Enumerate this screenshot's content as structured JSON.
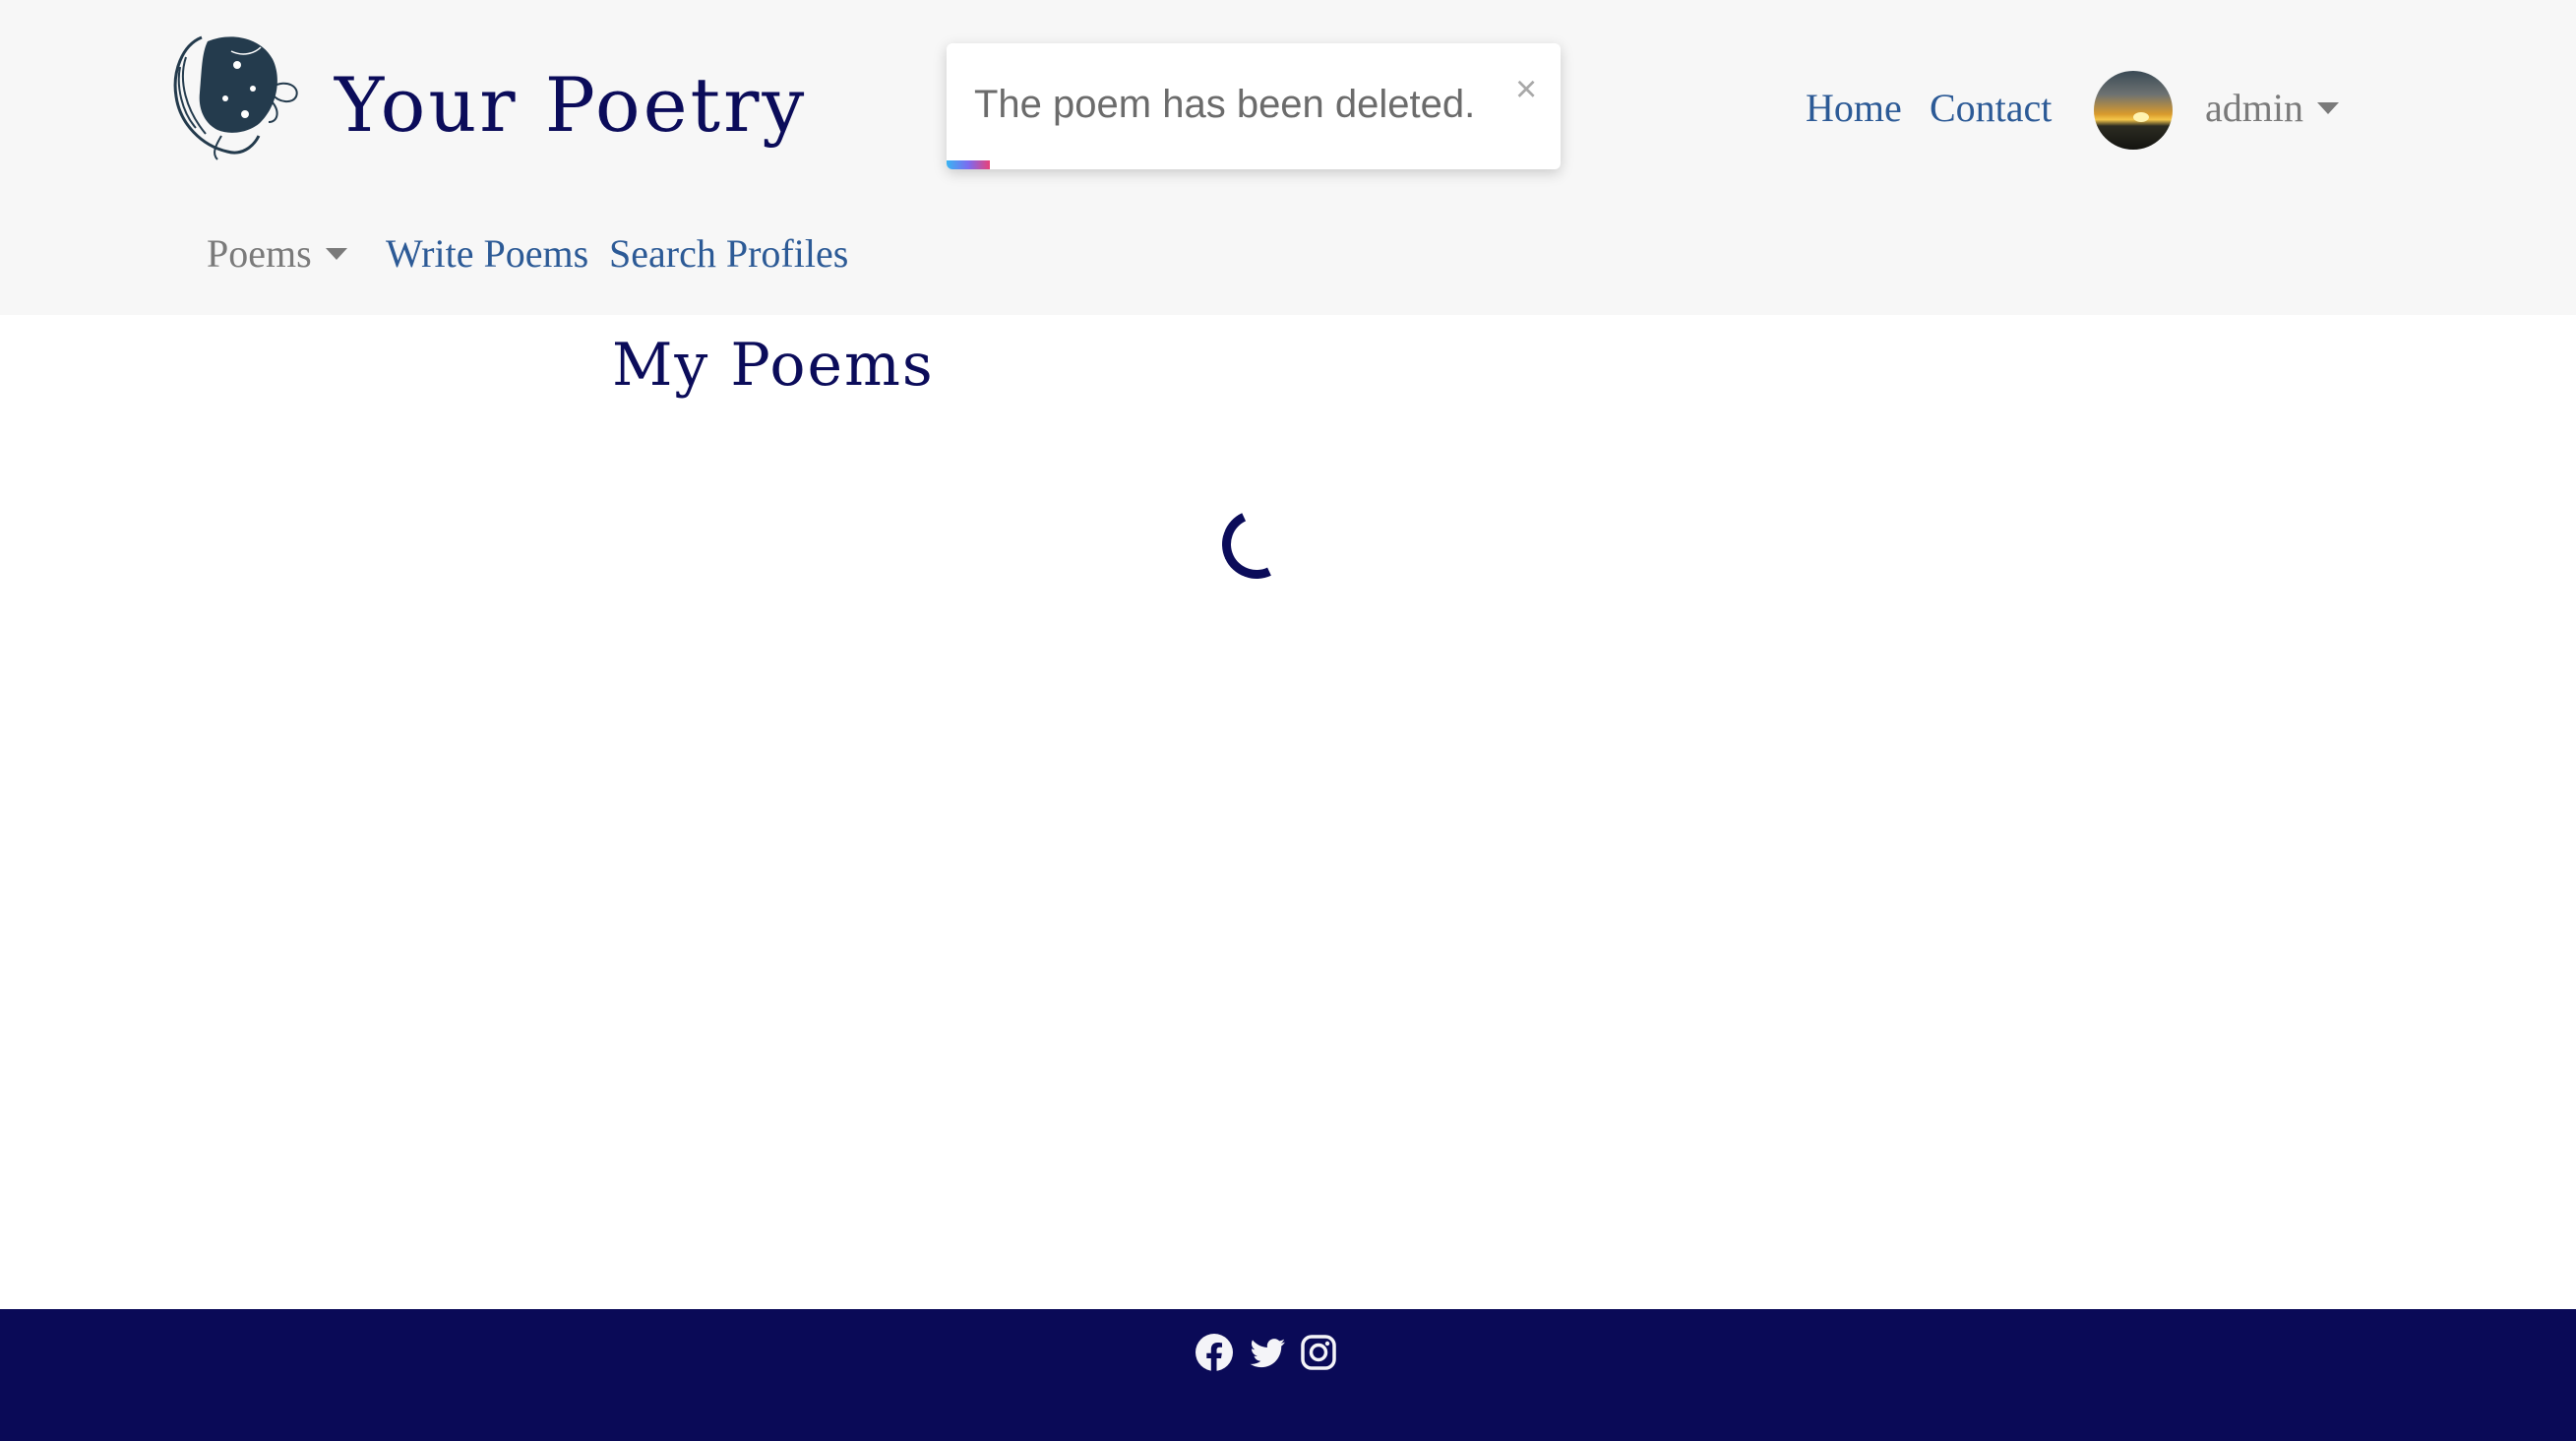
{
  "header": {
    "brand": "Your Poetry",
    "nav_left": [
      {
        "label": "Poems",
        "dropdown": true
      },
      {
        "label": "Write Poems"
      },
      {
        "label": "Search Profiles"
      }
    ],
    "nav_right": [
      {
        "label": "Home"
      },
      {
        "label": "Contact"
      }
    ],
    "user": {
      "label": "admin",
      "avatar": "sunset-photo"
    }
  },
  "toast": {
    "message": "The poem has been deleted.",
    "close": "×",
    "progress": 0.07
  },
  "main": {
    "title": "My Poems",
    "loading": true
  },
  "footer": {
    "social_icons": [
      "facebook-icon",
      "twitter-icon",
      "instagram-icon"
    ]
  },
  "colors": {
    "brand": "#0b0c5a",
    "link": "#2c5a96",
    "muted": "#7a7a7a",
    "header_bg": "#f7f7f7",
    "footer_bg": "#0a0a57"
  }
}
